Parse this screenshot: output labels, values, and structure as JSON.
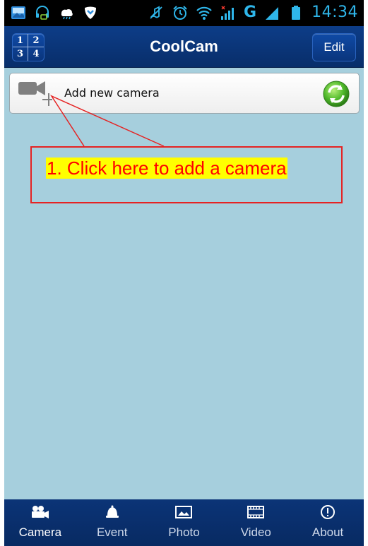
{
  "status_bar": {
    "left_icons": [
      "app-notification-icon",
      "headset-icon",
      "weather-icon",
      "shield-icon"
    ],
    "right_icons": [
      "mute-icon",
      "alarm-icon",
      "wifi-icon",
      "signal-icon",
      "battery-icon"
    ],
    "network_label": "G",
    "time": "14:34"
  },
  "header": {
    "grid_labels": [
      "1",
      "2",
      "3",
      "4"
    ],
    "title": "CoolCam",
    "edit_label": "Edit"
  },
  "camera_list": {
    "add_label": "Add new camera"
  },
  "annotation": {
    "text": "1. Click here to add a camera"
  },
  "bottom_nav": {
    "items": [
      {
        "label": "Camera",
        "icon": "camera-icon",
        "active": true
      },
      {
        "label": "Event",
        "icon": "bell-icon",
        "active": false
      },
      {
        "label": "Photo",
        "icon": "photo-icon",
        "active": false
      },
      {
        "label": "Video",
        "icon": "film-icon",
        "active": false
      },
      {
        "label": "About",
        "icon": "info-icon",
        "active": false
      }
    ]
  },
  "colors": {
    "title_bar": "#0a357c",
    "content_bg": "#a6cfdd",
    "status_accent": "#2fb6ea",
    "annotation_red": "#ff0000",
    "annotation_highlight": "#ffff00"
  }
}
